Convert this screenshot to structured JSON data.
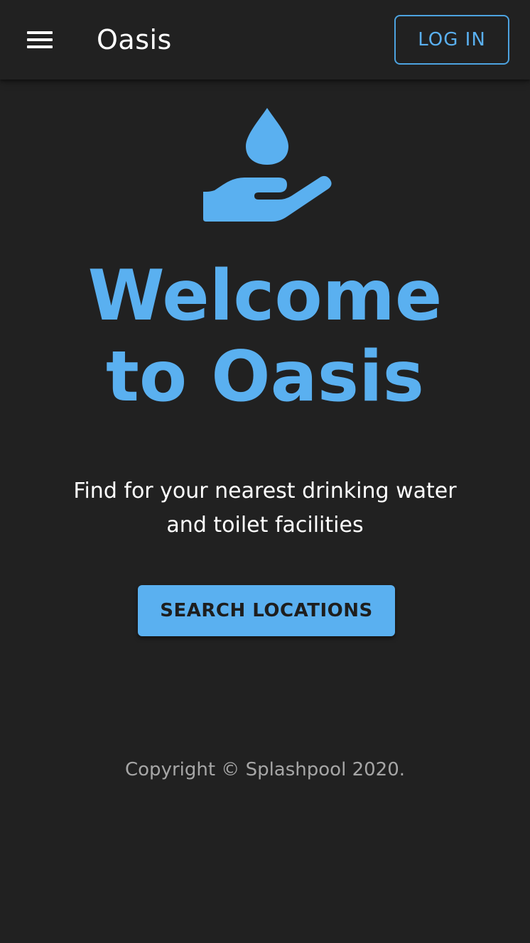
{
  "app": {
    "title": "Oasis"
  },
  "header": {
    "menu_icon": "hamburger-menu-icon",
    "login_label": "LOG IN"
  },
  "hero": {
    "icon": "water-drop-hand-icon",
    "title_line1": "Welcome",
    "title_line2": "to Oasis",
    "subtitle_line1": "Find for your nearest drinking water",
    "subtitle_line2": "and toilet facilities",
    "cta_label": "SEARCH LOCATIONS"
  },
  "footer": {
    "copyright": "Copyright © Splashpool 2020."
  },
  "colors": {
    "background": "#212121",
    "accent": "#5ab0f0",
    "text": "#ffffff",
    "muted": "#a6a6a6"
  }
}
